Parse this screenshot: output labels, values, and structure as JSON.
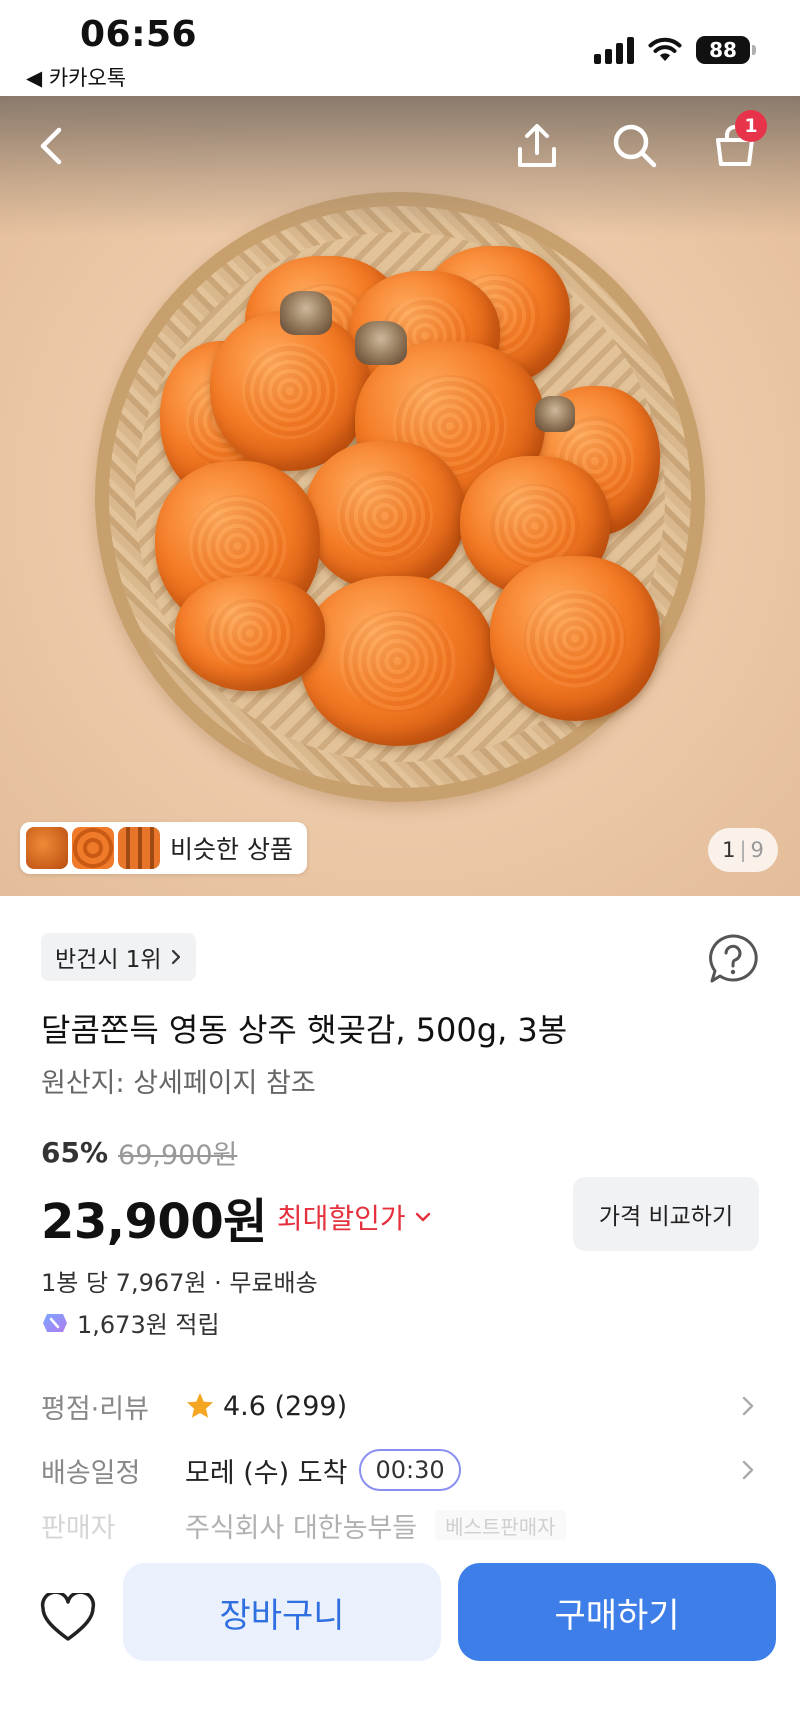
{
  "status_bar": {
    "time": "06:56",
    "back_app": "◀ 카카오톡",
    "battery": "88"
  },
  "header": {
    "cart_count": "1"
  },
  "gallery": {
    "similar_label": "비슷한 상품",
    "current_page": "1",
    "separator": "|",
    "total_pages": "9"
  },
  "product": {
    "rank": "반건시 1위",
    "title": "달콤쫀득 영동 상주 햇곶감, 500g, 3봉",
    "origin": "원산지: 상세페이지 참조",
    "discount": "65%",
    "original_price": "69,900원",
    "price": "23,900원",
    "max_discount_label": "최대할인가",
    "compare_label": "가격 비교하기",
    "per_unit": "1봉 당 7,967원 · 무료배송",
    "points": "1,673원 적립"
  },
  "details": {
    "rating_label": "평점·리뷰",
    "rating_value": "4.6 (299)",
    "delivery_label": "배송일정",
    "delivery_value": "모레 (수) 도착",
    "delivery_countdown": "00:30",
    "seller_label": "판매자",
    "seller_value": "주식회사 대한농부들",
    "seller_badge": "베스트판매자"
  },
  "bottom_bar": {
    "cart_label": "장바구니",
    "buy_label": "구매하기"
  },
  "colors": {
    "accent_blue": "#3d7ee8",
    "sale_red": "#e5303e",
    "badge_red": "#e8344a",
    "star": "#f5a623"
  }
}
